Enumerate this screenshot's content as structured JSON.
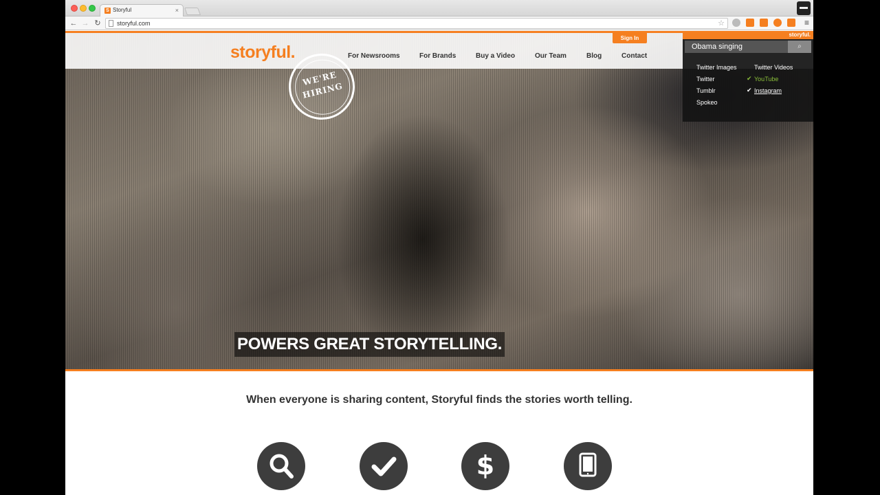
{
  "browser": {
    "tab_title": "Storyful",
    "tab_favicon": "S",
    "tab_close": "×",
    "url": "storyful.com",
    "nav_back": "←",
    "nav_forward": "→",
    "nav_reload": "↻",
    "star": "☆",
    "menu": "≡"
  },
  "site": {
    "logo": "storyful.",
    "sign_in": "Sign In",
    "nav": [
      "For Newsrooms",
      "For Brands",
      "Buy a Video",
      "Our Team",
      "Blog",
      "Contact"
    ],
    "hiring_line1": "WE'RE",
    "hiring_line2": "HIRING",
    "tagline": "POWERS GREAT STORYTELLING.",
    "subhead": "When everyone is sharing content, Storyful finds the stories worth telling.",
    "features": [
      {
        "icon": "search-icon"
      },
      {
        "icon": "check-icon"
      },
      {
        "icon": "dollar-icon"
      },
      {
        "icon": "tablet-icon"
      }
    ]
  },
  "popup": {
    "brand": "storyful.",
    "search_value": "Obama singing",
    "search_icon": "⌕",
    "sources_left": [
      "Twitter Images",
      "Twitter",
      "Tumblr",
      "Spokeo"
    ],
    "sources_right": [
      "Twitter Videos",
      "YouTube",
      "Instagram"
    ],
    "check": "✔"
  },
  "colors": {
    "accent": "#f57f20",
    "feature_bg": "#3d3d3d",
    "check_green": "#8bbf3a"
  }
}
